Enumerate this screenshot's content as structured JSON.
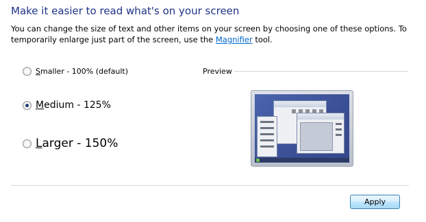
{
  "header": {
    "title": "Make it easier to read what's on your screen",
    "description_before_link": "You can change the size of text and other items on your screen by choosing one of these options. To temporarily enlarge just part of the screen, use the ",
    "link_text": "Magnifier",
    "description_after_link": " tool."
  },
  "options": [
    {
      "accel": "S",
      "rest": "maller - 100% (default)",
      "selected": false
    },
    {
      "accel": "M",
      "rest": "edium - 125%",
      "selected": true
    },
    {
      "accel": "L",
      "rest": "arger - 150%",
      "selected": false
    }
  ],
  "preview": {
    "label": "Preview"
  },
  "footer": {
    "apply_label": "Apply"
  },
  "colors": {
    "title": "#1e3287",
    "link": "#0066cc",
    "desktop": "#3b4f96"
  }
}
